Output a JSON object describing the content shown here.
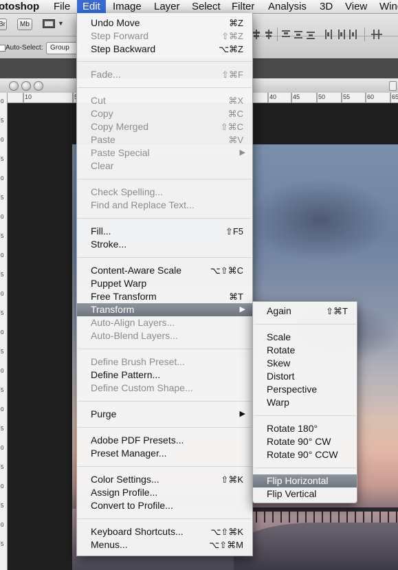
{
  "menubar": {
    "items": [
      "otoshop",
      "File",
      "Edit",
      "Image",
      "Layer",
      "Select",
      "Filter",
      "Analysis",
      "3D",
      "View",
      "Wind"
    ]
  },
  "options_bar": {
    "app_badge": "Mb",
    "auto_select_label": "Auto-Select:",
    "auto_select_value": "Group",
    "brief_label": "Br"
  },
  "ruler": {
    "top": [
      "10",
      "5",
      "40",
      "45",
      "50",
      "55",
      "60",
      "65"
    ],
    "left": [
      "0",
      "5",
      "0",
      "5",
      "0",
      "5",
      "0",
      "5",
      "0",
      "5",
      "0",
      "5",
      "0",
      "5",
      "0",
      "5",
      "0",
      "5",
      "0",
      "5",
      "0",
      "5",
      "0",
      "5"
    ]
  },
  "edit_menu": {
    "items": [
      {
        "label": "Undo Move",
        "shortcut": "⌘Z",
        "enabled": true
      },
      {
        "label": "Step Forward",
        "shortcut": "⇧⌘Z",
        "enabled": false
      },
      {
        "label": "Step Backward",
        "shortcut": "⌥⌘Z",
        "enabled": true
      },
      {
        "label": "Fade...",
        "shortcut": "⇧⌘F",
        "enabled": false
      },
      {
        "label": "Cut",
        "shortcut": "⌘X",
        "enabled": false
      },
      {
        "label": "Copy",
        "shortcut": "⌘C",
        "enabled": false
      },
      {
        "label": "Copy Merged",
        "shortcut": "⇧⌘C",
        "enabled": false
      },
      {
        "label": "Paste",
        "shortcut": "⌘V",
        "enabled": false
      },
      {
        "label": "Paste Special",
        "shortcut": "",
        "enabled": false,
        "submenu": true
      },
      {
        "label": "Clear",
        "shortcut": "",
        "enabled": false
      },
      {
        "label": "Check Spelling...",
        "shortcut": "",
        "enabled": false
      },
      {
        "label": "Find and Replace Text...",
        "shortcut": "",
        "enabled": false
      },
      {
        "label": "Fill...",
        "shortcut": "⇧F5",
        "enabled": true
      },
      {
        "label": "Stroke...",
        "shortcut": "",
        "enabled": true
      },
      {
        "label": "Content-Aware Scale",
        "shortcut": "⌥⇧⌘C",
        "enabled": true
      },
      {
        "label": "Puppet Warp",
        "shortcut": "",
        "enabled": true
      },
      {
        "label": "Free Transform",
        "shortcut": "⌘T",
        "enabled": true
      },
      {
        "label": "Transform",
        "shortcut": "",
        "enabled": true,
        "submenu": true,
        "highlighted": true
      },
      {
        "label": "Auto-Align Layers...",
        "shortcut": "",
        "enabled": false
      },
      {
        "label": "Auto-Blend Layers...",
        "shortcut": "",
        "enabled": false
      },
      {
        "label": "Define Brush Preset...",
        "shortcut": "",
        "enabled": false
      },
      {
        "label": "Define Pattern...",
        "shortcut": "",
        "enabled": true
      },
      {
        "label": "Define Custom Shape...",
        "shortcut": "",
        "enabled": false
      },
      {
        "label": "Purge",
        "shortcut": "",
        "enabled": true,
        "submenu": true
      },
      {
        "label": "Adobe PDF Presets...",
        "shortcut": "",
        "enabled": true
      },
      {
        "label": "Preset Manager...",
        "shortcut": "",
        "enabled": true
      },
      {
        "label": "Color Settings...",
        "shortcut": "⇧⌘K",
        "enabled": true
      },
      {
        "label": "Assign Profile...",
        "shortcut": "",
        "enabled": true
      },
      {
        "label": "Convert to Profile...",
        "shortcut": "",
        "enabled": true
      },
      {
        "label": "Keyboard Shortcuts...",
        "shortcut": "⌥⇧⌘K",
        "enabled": true
      },
      {
        "label": "Menus...",
        "shortcut": "⌥⇧⌘M",
        "enabled": true
      }
    ]
  },
  "transform_submenu": {
    "items": [
      {
        "label": "Again",
        "shortcut": "⇧⌘T",
        "enabled": true
      },
      {
        "label": "Scale",
        "shortcut": "",
        "enabled": true
      },
      {
        "label": "Rotate",
        "shortcut": "",
        "enabled": true
      },
      {
        "label": "Skew",
        "shortcut": "",
        "enabled": true
      },
      {
        "label": "Distort",
        "shortcut": "",
        "enabled": true
      },
      {
        "label": "Perspective",
        "shortcut": "",
        "enabled": true
      },
      {
        "label": "Warp",
        "shortcut": "",
        "enabled": true
      },
      {
        "label": "Rotate 180°",
        "shortcut": "",
        "enabled": true
      },
      {
        "label": "Rotate 90° CW",
        "shortcut": "",
        "enabled": true
      },
      {
        "label": "Rotate 90° CCW",
        "shortcut": "",
        "enabled": true
      },
      {
        "label": "Flip Horizontal",
        "shortcut": "",
        "enabled": true,
        "highlighted": true
      },
      {
        "label": "Flip Vertical",
        "shortcut": "",
        "enabled": true
      }
    ]
  },
  "colors": {
    "menu_highlight": "#7c828b",
    "active_menu_title": "#3a6bd2",
    "disabled_text": "#8c8c8c"
  }
}
